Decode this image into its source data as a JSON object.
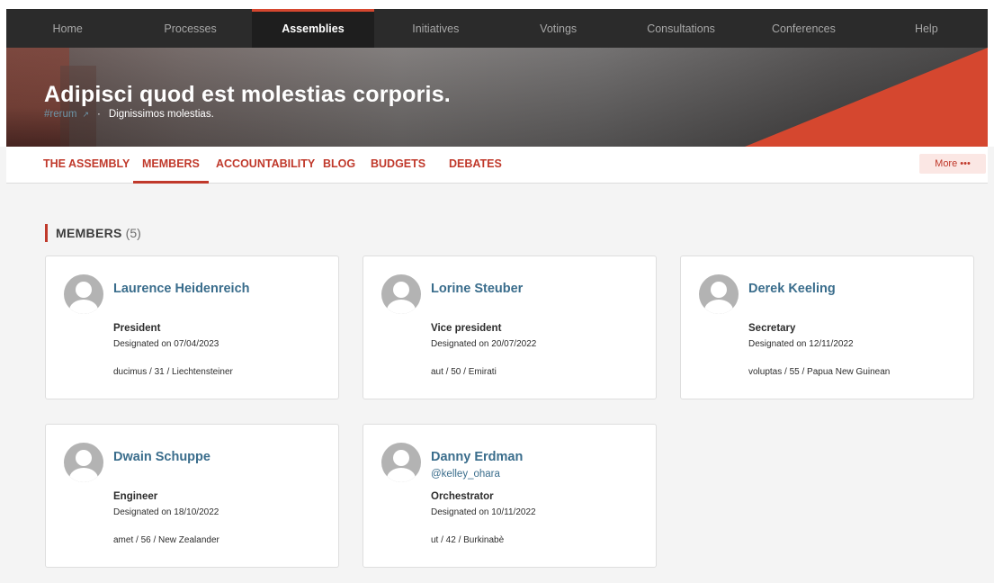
{
  "nav": {
    "items": [
      "Home",
      "Processes",
      "Assemblies",
      "Initiatives",
      "Votings",
      "Consultations",
      "Conferences",
      "Help"
    ],
    "active": "Assemblies"
  },
  "hero": {
    "title": "Adipisci quod est molestias corporis.",
    "hashtag": "#rerum",
    "subtitle": "Dignissimos molestias."
  },
  "subnav": {
    "items": [
      "THE ASSEMBLY",
      "MEMBERS",
      "ACCOUNTABILITY",
      "BLOG",
      "BUDGETS",
      "DEBATES"
    ],
    "active": "MEMBERS",
    "more_label": "More •••"
  },
  "section": {
    "label": "MEMBERS",
    "count": "(5)"
  },
  "members": [
    {
      "name": "Laurence Heidenreich",
      "nickname": "",
      "role": "President",
      "designated": "Designated on 07/04/2023",
      "meta": "ducimus / 31 / Liechtensteiner"
    },
    {
      "name": "Lorine Steuber",
      "nickname": "",
      "role": "Vice president",
      "designated": "Designated on 20/07/2022",
      "meta": "aut / 50 / Emirati"
    },
    {
      "name": "Derek Keeling",
      "nickname": "",
      "role": "Secretary",
      "designated": "Designated on 12/11/2022",
      "meta": "voluptas / 55 / Papua New Guinean"
    },
    {
      "name": "Dwain Schuppe",
      "nickname": "",
      "role": "Engineer",
      "designated": "Designated on 18/10/2022",
      "meta": "amet / 56 / New Zealander"
    },
    {
      "name": "Danny Erdman",
      "nickname": "@kelley_ohara",
      "role": "Orchestrator",
      "designated": "Designated on 10/11/2022",
      "meta": "ut / 42 / Burkinabè"
    }
  ],
  "colors": {
    "accent": "#c0392b",
    "link": "#3a6d8c",
    "nav_bg": "#2b2b2b"
  }
}
